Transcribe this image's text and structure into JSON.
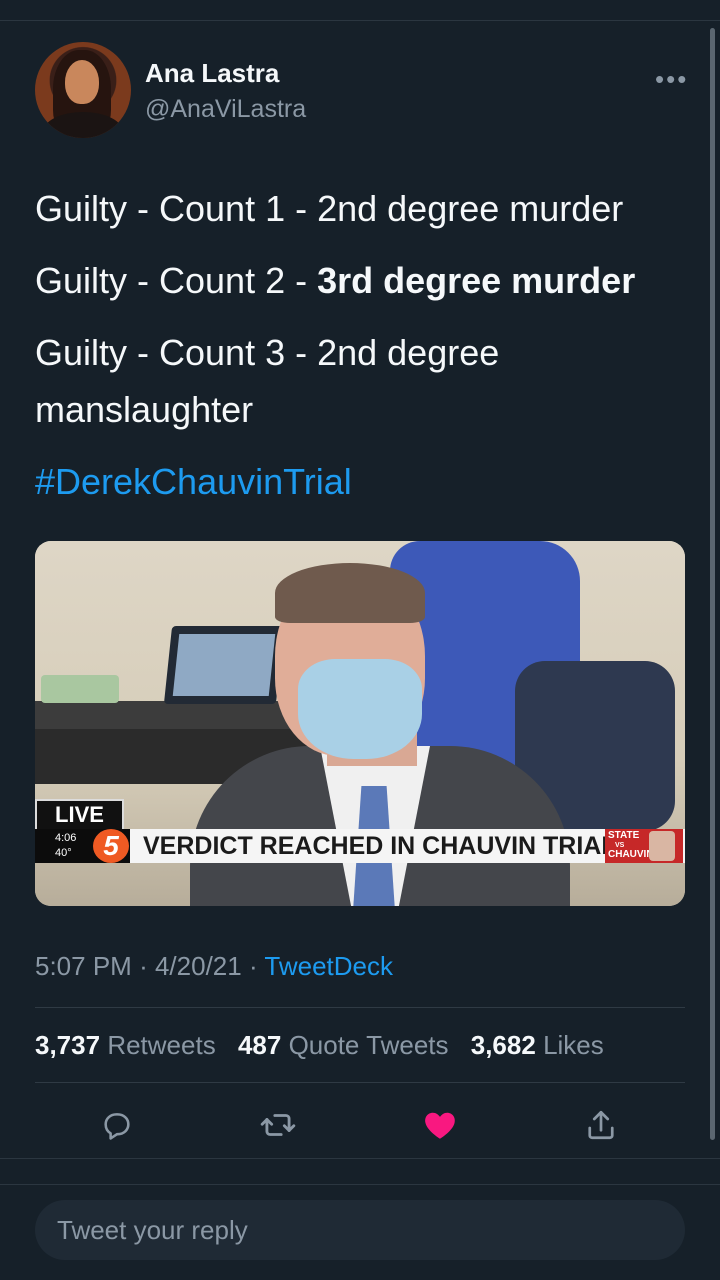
{
  "author": {
    "name": "Ana Lastra",
    "handle": "@AnaViLastra"
  },
  "tweet": {
    "line1": "Guilty - Count 1 - 2nd degree murder",
    "line2_prefix": "Guilty - Count 2 - ",
    "line2_bold": "3rd degree murder",
    "line3": "Guilty - Count 3 - 2nd degree manslaughter",
    "hashtag": "#DerekChauvinTrial"
  },
  "media": {
    "live_label": "LIVE",
    "time": "4:06",
    "temperature": "40°",
    "channel_logo": "5",
    "headline": "VERDICT REACHED IN CHAUVIN TRIAL",
    "badge_top": "STATE",
    "badge_mid": "VS",
    "badge_bottom": "CHAUVIN"
  },
  "meta": {
    "time": "5:07 PM",
    "separator": "·",
    "date": "4/20/21",
    "source": "TweetDeck"
  },
  "stats": {
    "retweets_count": "3,737",
    "retweets_label": "Retweets",
    "quotes_count": "487",
    "quotes_label": "Quote Tweets",
    "likes_count": "3,682",
    "likes_label": "Likes"
  },
  "reply": {
    "placeholder": "Tweet your reply"
  },
  "colors": {
    "background": "#162029",
    "link": "#1d9bf0",
    "like_active": "#f91880",
    "muted": "#8b98a5"
  },
  "icons": {
    "more": "more-icon",
    "reply": "reply-icon",
    "retweet": "retweet-icon",
    "like": "heart-icon",
    "share": "share-icon"
  }
}
